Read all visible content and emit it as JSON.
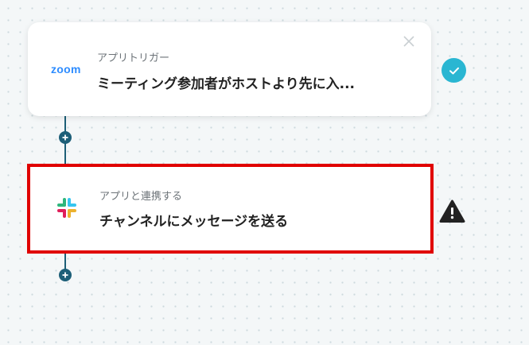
{
  "steps": [
    {
      "app_logo_text": "zoom",
      "subtitle": "アプリトリガー",
      "title": "ミーティング参加者がホストより先に入...",
      "status_icon": "check-circle-icon",
      "close_icon": "close-icon"
    },
    {
      "app_logo": "slack-logo",
      "subtitle": "アプリと連携する",
      "title": "チャンネルにメッセージを送る",
      "status_icon": "warning-icon"
    }
  ],
  "colors": {
    "zoom_blue": "#2d8cff",
    "connector": "#1d5f78",
    "check_badge": "#2ab6d2",
    "highlight_border": "#e00000",
    "warning": "#222222"
  }
}
